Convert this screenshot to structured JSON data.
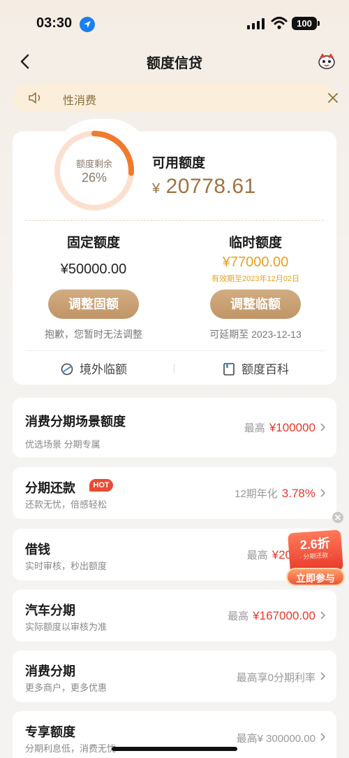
{
  "status_bar": {
    "time": "03:30",
    "battery": "100"
  },
  "nav": {
    "title": "额度信贷"
  },
  "notice": {
    "text": "性消费"
  },
  "quota": {
    "gauge_label": "额度剩余",
    "gauge_percent_text": "26%",
    "gauge_fraction": 0.26,
    "available_label": "可用额度",
    "available_currency": "¥",
    "available_amount": "20778.61"
  },
  "fixed": {
    "title": "固定额度",
    "amount": "¥50000.00",
    "button": "调整固额",
    "note": "抱歉，您暂时无法调整"
  },
  "temporary": {
    "title": "临时额度",
    "amount": "¥77000.00",
    "validity": "有效期至2023年12月02日",
    "button": "调整临额",
    "note": "可延期至 2023-12-13"
  },
  "card_footer": {
    "overseas": "境外临额",
    "encyclopedia": "额度百科"
  },
  "rows": [
    {
      "title": "消费分期场景额度",
      "subtitle": "优选场景 分期专属",
      "prefix": "最高",
      "value": "¥100000"
    },
    {
      "title": "分期还款",
      "badge": "HOT",
      "subtitle": "还款无忧，倍感轻松",
      "prefix": "12期年化",
      "value": "3.78%"
    },
    {
      "title": "借钱",
      "subtitle": "实时审核，秒出额度",
      "prefix": "最高",
      "value": "¥20"
    },
    {
      "title": "汽车分期",
      "subtitle": "实际额度以审核为准",
      "prefix": "最高",
      "value": "¥167000.00"
    },
    {
      "title": "消费分期",
      "subtitle": "更多商户，更多优惠",
      "prefix": "最高享0分期利率",
      "value": ""
    },
    {
      "title": "专享额度",
      "subtitle": "分期利息低，消费无忧",
      "prefix": "最高",
      "value": "¥ 300000.00"
    }
  ],
  "promo": {
    "discount": "2.6折",
    "label": "· 分期还款 ·",
    "button": "立即参与"
  },
  "colors": {
    "gold": "#a07341",
    "accent_red": "#e5392a",
    "temp_yellow": "#e6a21c",
    "gauge_orange": "#f07a2e"
  }
}
